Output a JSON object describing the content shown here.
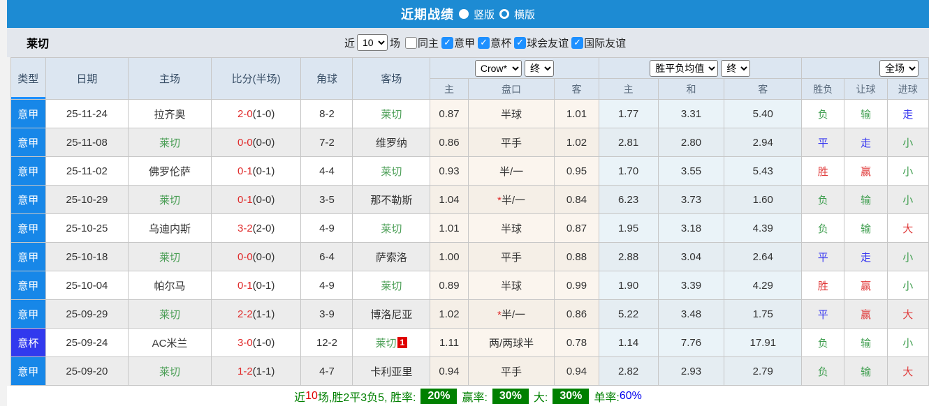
{
  "title_bar": {
    "title": "近期战绩",
    "radios": [
      {
        "label": "竖版",
        "selected": true
      },
      {
        "label": "横版",
        "selected": false
      }
    ]
  },
  "filter_bar": {
    "team": "莱切",
    "near_label": "近",
    "games_value": "10",
    "games_suffix": "场",
    "checkboxes": [
      {
        "label": "同主",
        "checked": false
      },
      {
        "label": "意甲",
        "checked": true
      },
      {
        "label": "意杯",
        "checked": true
      },
      {
        "label": "球会友谊",
        "checked": true
      },
      {
        "label": "国际友谊",
        "checked": true
      }
    ]
  },
  "table": {
    "headers": {
      "type": "类型",
      "date": "日期",
      "home": "主场",
      "score": "比分(半场)",
      "corner": "角球",
      "away": "客场",
      "odds_home": "主",
      "handicap": "盘口",
      "odds_away": "客",
      "avg_home": "主",
      "avg_draw": "和",
      "avg_away": "客",
      "result": "胜负",
      "handicap_result": "让球",
      "goals_result": "进球"
    },
    "selects": {
      "odds_source": "Crow*",
      "odds_time": "终",
      "avg_source": "胜平负均值",
      "avg_time": "终",
      "scope": "全场"
    },
    "colors": {
      "league_blue": "#1787e8",
      "cup_blue": "#3139ee",
      "team_green": "#4a9e55",
      "win_red": "#e03c3c",
      "draw_blue": "#3a3af0",
      "lose_green": "#3f9e4f"
    },
    "rows": [
      {
        "type": "意甲",
        "is_cup": false,
        "date": "25-11-24",
        "home": "拉齐奥",
        "home_is_team": false,
        "score_ft": "2-0",
        "score_ht": "(1-0)",
        "corner": "8-2",
        "away": "莱切",
        "away_is_team": true,
        "away_badge": "",
        "odds_home": "0.87",
        "handicap_star": false,
        "handicap": "半球",
        "odds_away": "1.01",
        "avg_home": "1.77",
        "avg_draw": "3.31",
        "avg_away": "5.40",
        "result": "负",
        "handicap_result": "输",
        "goals_result": "走"
      },
      {
        "type": "意甲",
        "is_cup": false,
        "date": "25-11-08",
        "home": "莱切",
        "home_is_team": true,
        "score_ft": "0-0",
        "score_ht": "(0-0)",
        "corner": "7-2",
        "away": "维罗纳",
        "away_is_team": false,
        "away_badge": "",
        "odds_home": "0.86",
        "handicap_star": false,
        "handicap": "平手",
        "odds_away": "1.02",
        "avg_home": "2.81",
        "avg_draw": "2.80",
        "avg_away": "2.94",
        "result": "平",
        "handicap_result": "走",
        "goals_result": "小"
      },
      {
        "type": "意甲",
        "is_cup": false,
        "date": "25-11-02",
        "home": "佛罗伦萨",
        "home_is_team": false,
        "score_ft": "0-1",
        "score_ht": "(0-1)",
        "corner": "4-4",
        "away": "莱切",
        "away_is_team": true,
        "away_badge": "",
        "odds_home": "0.93",
        "handicap_star": false,
        "handicap": "半/一",
        "odds_away": "0.95",
        "avg_home": "1.70",
        "avg_draw": "3.55",
        "avg_away": "5.43",
        "result": "胜",
        "handicap_result": "赢",
        "goals_result": "小"
      },
      {
        "type": "意甲",
        "is_cup": false,
        "date": "25-10-29",
        "home": "莱切",
        "home_is_team": true,
        "score_ft": "0-1",
        "score_ht": "(0-0)",
        "corner": "3-5",
        "away": "那不勒斯",
        "away_is_team": false,
        "away_badge": "",
        "odds_home": "1.04",
        "handicap_star": true,
        "handicap": "半/一",
        "odds_away": "0.84",
        "avg_home": "6.23",
        "avg_draw": "3.73",
        "avg_away": "1.60",
        "result": "负",
        "handicap_result": "输",
        "goals_result": "小"
      },
      {
        "type": "意甲",
        "is_cup": false,
        "date": "25-10-25",
        "home": "乌迪内斯",
        "home_is_team": false,
        "score_ft": "3-2",
        "score_ht": "(2-0)",
        "corner": "4-9",
        "away": "莱切",
        "away_is_team": true,
        "away_badge": "",
        "odds_home": "1.01",
        "handicap_star": false,
        "handicap": "半球",
        "odds_away": "0.87",
        "avg_home": "1.95",
        "avg_draw": "3.18",
        "avg_away": "4.39",
        "result": "负",
        "handicap_result": "输",
        "goals_result": "大"
      },
      {
        "type": "意甲",
        "is_cup": false,
        "date": "25-10-18",
        "home": "莱切",
        "home_is_team": true,
        "score_ft": "0-0",
        "score_ht": "(0-0)",
        "corner": "6-4",
        "away": "萨索洛",
        "away_is_team": false,
        "away_badge": "",
        "odds_home": "1.00",
        "handicap_star": false,
        "handicap": "平手",
        "odds_away": "0.88",
        "avg_home": "2.88",
        "avg_draw": "3.04",
        "avg_away": "2.64",
        "result": "平",
        "handicap_result": "走",
        "goals_result": "小"
      },
      {
        "type": "意甲",
        "is_cup": false,
        "date": "25-10-04",
        "home": "帕尔马",
        "home_is_team": false,
        "score_ft": "0-1",
        "score_ht": "(0-1)",
        "corner": "4-9",
        "away": "莱切",
        "away_is_team": true,
        "away_badge": "",
        "odds_home": "0.89",
        "handicap_star": false,
        "handicap": "半球",
        "odds_away": "0.99",
        "avg_home": "1.90",
        "avg_draw": "3.39",
        "avg_away": "4.29",
        "result": "胜",
        "handicap_result": "赢",
        "goals_result": "小"
      },
      {
        "type": "意甲",
        "is_cup": false,
        "date": "25-09-29",
        "home": "莱切",
        "home_is_team": true,
        "score_ft": "2-2",
        "score_ht": "(1-1)",
        "corner": "3-9",
        "away": "博洛尼亚",
        "away_is_team": false,
        "away_badge": "",
        "odds_home": "1.02",
        "handicap_star": true,
        "handicap": "半/一",
        "odds_away": "0.86",
        "avg_home": "5.22",
        "avg_draw": "3.48",
        "avg_away": "1.75",
        "result": "平",
        "handicap_result": "赢",
        "goals_result": "大"
      },
      {
        "type": "意杯",
        "is_cup": true,
        "date": "25-09-24",
        "home": "AC米兰",
        "home_is_team": false,
        "score_ft": "3-0",
        "score_ht": "(1-0)",
        "corner": "12-2",
        "away": "莱切",
        "away_is_team": true,
        "away_badge": "1",
        "odds_home": "1.11",
        "handicap_star": false,
        "handicap": "两/两球半",
        "odds_away": "0.78",
        "avg_home": "1.14",
        "avg_draw": "7.76",
        "avg_away": "17.91",
        "result": "负",
        "handicap_result": "输",
        "goals_result": "小"
      },
      {
        "type": "意甲",
        "is_cup": false,
        "date": "25-09-20",
        "home": "莱切",
        "home_is_team": true,
        "score_ft": "1-2",
        "score_ht": "(1-1)",
        "corner": "4-7",
        "away": "卡利亚里",
        "away_is_team": false,
        "away_badge": "",
        "odds_home": "0.94",
        "handicap_star": false,
        "handicap": "平手",
        "odds_away": "0.94",
        "avg_home": "2.82",
        "avg_draw": "2.93",
        "avg_away": "2.79",
        "result": "负",
        "handicap_result": "输",
        "goals_result": "大"
      }
    ]
  },
  "summary": {
    "segments": [
      {
        "text": "近",
        "style": "green"
      },
      {
        "text": "10",
        "style": "red"
      },
      {
        "text": "场,胜2平3负5, 胜率:",
        "style": "green"
      },
      {
        "text": "20%",
        "style": "badge"
      },
      {
        "text": "赢率:",
        "style": "green"
      },
      {
        "text": "30%",
        "style": "badge"
      },
      {
        "text": "大:",
        "style": "green"
      },
      {
        "text": "30%",
        "style": "badge"
      },
      {
        "text": "单率:",
        "style": "green"
      },
      {
        "text": "60%",
        "style": "blue"
      }
    ]
  }
}
